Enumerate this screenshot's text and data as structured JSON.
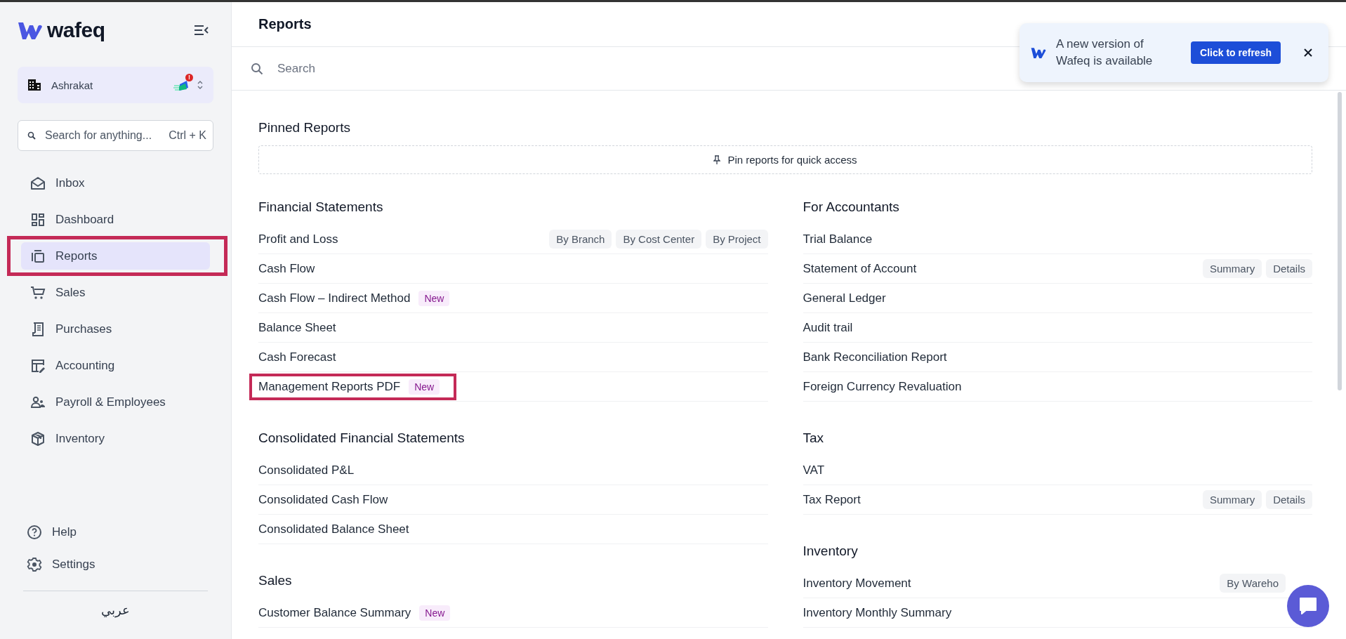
{
  "sidebar": {
    "logo": "wafeq",
    "org": {
      "name": "Ashrakat",
      "alert": "!"
    },
    "search": {
      "placeholder": "Search for anything...",
      "shortcut": "Ctrl + K"
    },
    "items": [
      {
        "label": "Inbox",
        "selected": false,
        "highlighted": false
      },
      {
        "label": "Dashboard",
        "selected": false,
        "highlighted": false
      },
      {
        "label": "Reports",
        "selected": true,
        "highlighted": true
      },
      {
        "label": "Sales",
        "selected": false,
        "highlighted": false
      },
      {
        "label": "Purchases",
        "selected": false,
        "highlighted": false
      },
      {
        "label": "Accounting",
        "selected": false,
        "highlighted": false
      },
      {
        "label": "Payroll & Employees",
        "selected": false,
        "highlighted": false
      },
      {
        "label": "Inventory",
        "selected": false,
        "highlighted": false
      }
    ],
    "footer_items": [
      {
        "label": "Help"
      },
      {
        "label": "Settings"
      }
    ],
    "language": "عربي"
  },
  "header": {
    "title": "Reports"
  },
  "search": {
    "placeholder": "Search"
  },
  "pinned": {
    "title": "Pinned Reports",
    "empty_text": "Pin reports for quick access"
  },
  "columns": [
    [
      {
        "title": "Financial Statements",
        "rows": [
          {
            "title": "Profit and Loss",
            "tags": [
              "By Branch",
              "By Cost Center",
              "By Project"
            ],
            "highlighted": false
          },
          {
            "title": "Cash Flow",
            "highlighted": false
          },
          {
            "title": "Cash Flow – Indirect Method",
            "badge": "New",
            "highlighted": false
          },
          {
            "title": "Balance Sheet",
            "highlighted": false
          },
          {
            "title": "Cash Forecast",
            "highlighted": false
          },
          {
            "title": "Management Reports PDF",
            "badge": "New",
            "highlighted": true
          }
        ]
      },
      {
        "title": "Consolidated Financial Statements",
        "rows": [
          {
            "title": "Consolidated P&L",
            "highlighted": false
          },
          {
            "title": "Consolidated Cash Flow",
            "highlighted": false
          },
          {
            "title": "Consolidated Balance Sheet",
            "highlighted": false
          }
        ]
      },
      {
        "title": "Sales",
        "rows": [
          {
            "title": "Customer Balance Summary",
            "badge": "New",
            "highlighted": false
          }
        ]
      }
    ],
    [
      {
        "title": "For Accountants",
        "rows": [
          {
            "title": "Trial Balance",
            "highlighted": false
          },
          {
            "title": "Statement of Account",
            "tags": [
              "Summary",
              "Details"
            ],
            "highlighted": false
          },
          {
            "title": "General Ledger",
            "highlighted": false
          },
          {
            "title": "Audit trail",
            "highlighted": false
          },
          {
            "title": "Bank Reconciliation Report",
            "highlighted": false
          },
          {
            "title": "Foreign Currency Revaluation",
            "highlighted": false
          }
        ]
      },
      {
        "title": "Tax",
        "rows": [
          {
            "title": "VAT",
            "highlighted": false
          },
          {
            "title": "Tax Report",
            "tags": [
              "Summary",
              "Details"
            ],
            "highlighted": false
          }
        ]
      },
      {
        "title": "Inventory",
        "rows": [
          {
            "title": "Inventory Movement",
            "tags": [
              "By Wareho"
            ],
            "highlighted": false
          },
          {
            "title": "Inventory Monthly Summary",
            "highlighted": false
          }
        ]
      }
    ]
  ],
  "toast": {
    "message": "A new version of Wafeq is available",
    "action": "Click to refresh"
  }
}
